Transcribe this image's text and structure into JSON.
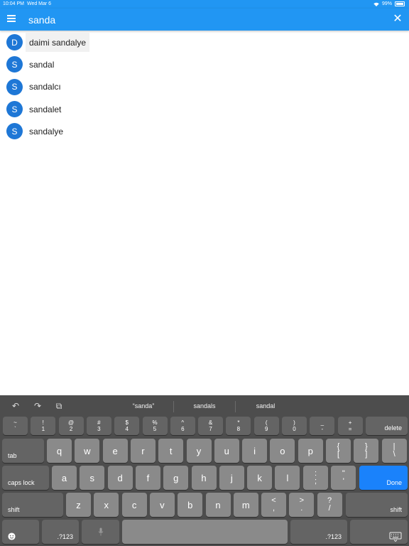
{
  "status": {
    "time": "10:04 PM",
    "date": "Wed Mar 6",
    "battery": "99%"
  },
  "appbar": {
    "search_value": "sanda"
  },
  "results": [
    {
      "initial": "D",
      "label": "daimi sandalye"
    },
    {
      "initial": "S",
      "label": "sandal"
    },
    {
      "initial": "S",
      "label": "sandalcı"
    },
    {
      "initial": "S",
      "label": "sandalet"
    },
    {
      "initial": "S",
      "label": "sandalye"
    }
  ],
  "keyboard": {
    "suggestions": [
      "“sanda”",
      "sandals",
      "sandal"
    ],
    "number_row": [
      {
        "top": "~",
        "bottom": "`"
      },
      {
        "top": "!",
        "bottom": "1"
      },
      {
        "top": "@",
        "bottom": "2"
      },
      {
        "top": "#",
        "bottom": "3"
      },
      {
        "top": "$",
        "bottom": "4"
      },
      {
        "top": "%",
        "bottom": "5"
      },
      {
        "top": "^",
        "bottom": "6"
      },
      {
        "top": "&",
        "bottom": "7"
      },
      {
        "top": "*",
        "bottom": "8"
      },
      {
        "top": "(",
        "bottom": "9"
      },
      {
        "top": ")",
        "bottom": "0"
      },
      {
        "top": "_",
        "bottom": "-"
      },
      {
        "top": "+",
        "bottom": "="
      }
    ],
    "delete": "delete",
    "tab": "tab",
    "row_q": [
      "q",
      "w",
      "e",
      "r",
      "t",
      "y",
      "u",
      "i",
      "o",
      "p"
    ],
    "brackets": [
      {
        "top": "{",
        "bottom": "["
      },
      {
        "top": "}",
        "bottom": "]"
      },
      {
        "top": "|",
        "bottom": "\\"
      }
    ],
    "caps": "caps lock",
    "row_a": [
      "a",
      "s",
      "d",
      "f",
      "g",
      "h",
      "j",
      "k",
      "l"
    ],
    "punct_a": [
      {
        "top": ":",
        "bottom": ";"
      },
      {
        "top": "\"",
        "bottom": "'"
      }
    ],
    "done": "Done",
    "shift": "shift",
    "row_z": [
      "z",
      "x",
      "c",
      "v",
      "b",
      "n",
      "m"
    ],
    "punct_z": [
      {
        "top": "<",
        "bottom": ","
      },
      {
        "top": ">",
        "bottom": "."
      },
      {
        "top": "?",
        "bottom": "/"
      }
    ],
    "numbers_key": ".?123"
  }
}
